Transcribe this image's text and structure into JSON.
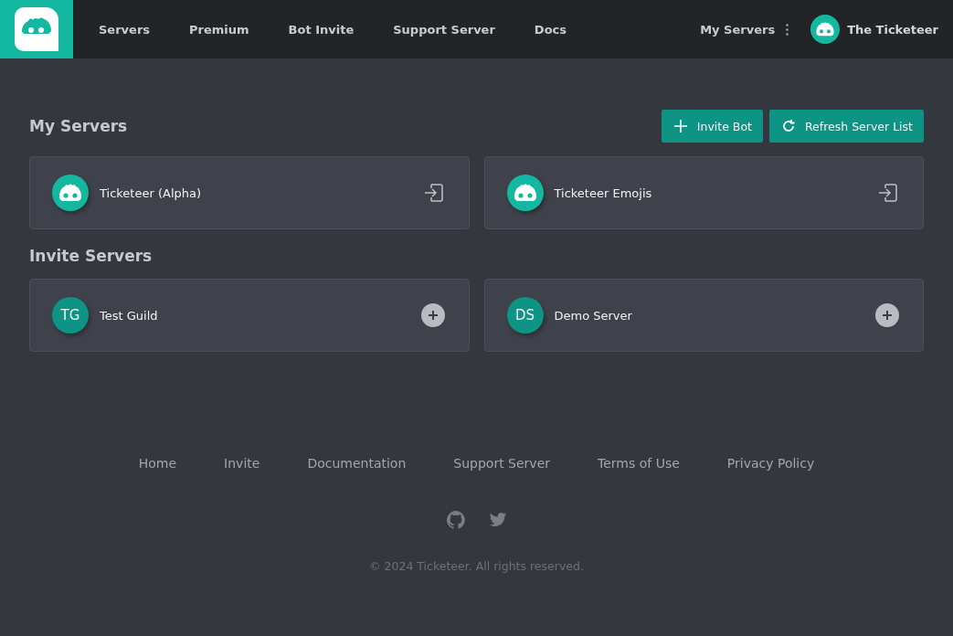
{
  "header": {
    "nav": [
      "Servers",
      "Premium",
      "Bot Invite",
      "Support Server",
      "Docs"
    ],
    "menu_label": "My Servers",
    "user_name": "The Ticketeer"
  },
  "my_servers": {
    "title": "My Servers",
    "buttons": [
      {
        "kind": "add",
        "label": "Invite Bot"
      },
      {
        "kind": "refresh",
        "label": "Refresh Server List"
      }
    ],
    "servers": [
      {
        "kind": "joined",
        "name": "Ticketeer (Alpha)"
      },
      {
        "kind": "joined",
        "name": "Ticketeer Emojis"
      }
    ]
  },
  "invite_servers": {
    "title": "Invite Servers",
    "servers": [
      {
        "kind": "invite",
        "initials": "TG",
        "name": "Test Guild"
      },
      {
        "kind": "invite",
        "initials": "DS",
        "name": "Demo Server"
      }
    ]
  },
  "footer": {
    "links": [
      "Home",
      "Invite",
      "Documentation",
      "Support Server",
      "Terms of Use",
      "Privacy Policy"
    ],
    "copyright": "© 2024 Ticketeer. All rights reserved."
  }
}
